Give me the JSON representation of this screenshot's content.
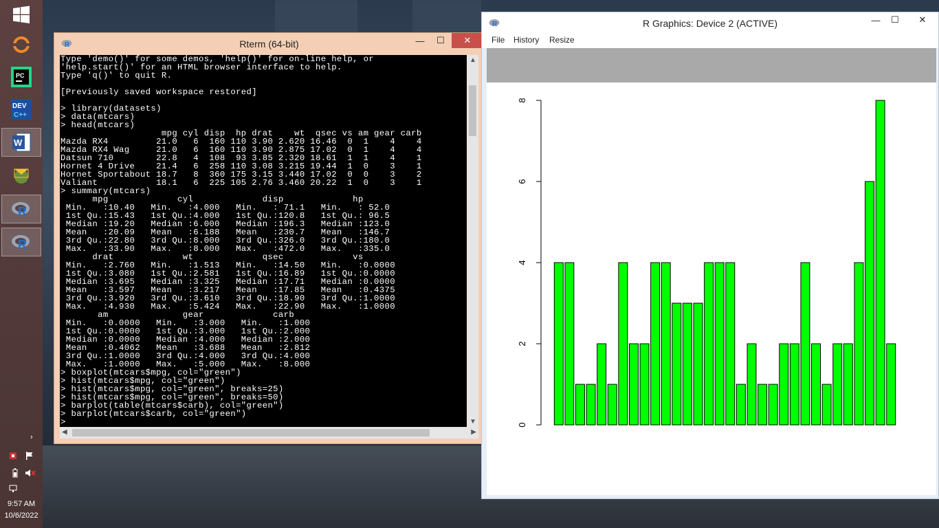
{
  "taskbar": {
    "items": [
      {
        "name": "windows-start-icon"
      },
      {
        "name": "orange-app-icon"
      },
      {
        "name": "pycharm-icon"
      },
      {
        "name": "devcpp-icon"
      },
      {
        "name": "word-icon"
      },
      {
        "name": "mail-app-icon"
      },
      {
        "name": "r-icon"
      },
      {
        "name": "r-icon-2"
      }
    ],
    "clock_time": "9:57 AM",
    "clock_date": "10/6/2022",
    "tray_arrow": "›"
  },
  "rterm": {
    "title": "Rterm (64-bit)",
    "lines": [
      "Type 'demo()' for some demos, 'help()' for on-line help, or",
      "'help.start()' for an HTML browser interface to help.",
      "Type 'q()' to quit R.",
      "",
      "[Previously saved workspace restored]",
      "",
      "> library(datasets)",
      "> data(mtcars)",
      "> head(mtcars)",
      "                   mpg cyl disp  hp drat    wt  qsec vs am gear carb",
      "Mazda RX4         21.0   6  160 110 3.90 2.620 16.46  0  1    4    4",
      "Mazda RX4 Wag     21.0   6  160 110 3.90 2.875 17.02  0  1    4    4",
      "Datsun 710        22.8   4  108  93 3.85 2.320 18.61  1  1    4    1",
      "Hornet 4 Drive    21.4   6  258 110 3.08 3.215 19.44  1  0    3    1",
      "Hornet Sportabout 18.7   8  360 175 3.15 3.440 17.02  0  0    3    2",
      "Valiant           18.1   6  225 105 2.76 3.460 20.22  1  0    3    1",
      "> summary(mtcars)",
      "      mpg             cyl             disp             hp",
      " Min.   :10.40   Min.   :4.000   Min.   : 71.1   Min.   : 52.0",
      " 1st Qu.:15.43   1st Qu.:4.000   1st Qu.:120.8   1st Qu.: 96.5",
      " Median :19.20   Median :6.000   Median :196.3   Median :123.0",
      " Mean   :20.09   Mean   :6.188   Mean   :230.7   Mean   :146.7",
      " 3rd Qu.:22.80   3rd Qu.:8.000   3rd Qu.:326.0   3rd Qu.:180.0",
      " Max.   :33.90   Max.   :8.000   Max.   :472.0   Max.   :335.0",
      "      drat             wt             qsec             vs",
      " Min.   :2.760   Min.   :1.513   Min.   :14.50   Min.   :0.0000",
      " 1st Qu.:3.080   1st Qu.:2.581   1st Qu.:16.89   1st Qu.:0.0000",
      " Median :3.695   Median :3.325   Median :17.71   Median :0.0000",
      " Mean   :3.597   Mean   :3.217   Mean   :17.85   Mean   :0.4375",
      " 3rd Qu.:3.920   3rd Qu.:3.610   3rd Qu.:18.90   3rd Qu.:1.0000",
      " Max.   :4.930   Max.   :5.424   Max.   :22.90   Max.   :1.0000",
      "       am              gear             carb",
      " Min.   :0.0000   Min.   :3.000   Min.   :1.000",
      " 1st Qu.:0.0000   1st Qu.:3.000   1st Qu.:2.000",
      " Median :0.0000   Median :4.000   Median :2.000",
      " Mean   :0.4062   Mean   :3.688   Mean   :2.812",
      " 3rd Qu.:1.0000   3rd Qu.:4.000   3rd Qu.:4.000",
      " Max.   :1.0000   Max.   :5.000   Max.   :8.000",
      "> boxplot(mtcars$mpg, col=\"green\")",
      "> hist(mtcars$mpg, col=\"green\")",
      "> hist(mtcars$mpg, col=\"green\", breaks=25)",
      "> hist(mtcars$mpg, col=\"green\", breaks=50)",
      "> barplot(table(mtcars$carb), col=\"green\")",
      "> barplot(mtcars$carb, col=\"green\")",
      ">"
    ]
  },
  "graphics": {
    "title": "R Graphics: Device 2 (ACTIVE)",
    "menu": [
      "File",
      "History",
      "Resize"
    ]
  },
  "window_controls": {
    "minimize": "—",
    "maximize": "☐",
    "close": "✕"
  },
  "chart_data": {
    "type": "bar",
    "values": [
      4,
      4,
      1,
      1,
      2,
      1,
      4,
      2,
      2,
      4,
      4,
      3,
      3,
      3,
      4,
      4,
      4,
      1,
      2,
      1,
      1,
      2,
      2,
      4,
      2,
      1,
      2,
      2,
      4,
      6,
      8,
      2
    ],
    "ylim": [
      0,
      8
    ],
    "yticks": [
      "0",
      "2",
      "4",
      "6",
      "8"
    ],
    "bar_color": "#00ff00",
    "title": "",
    "xlabel": "",
    "ylabel": ""
  }
}
